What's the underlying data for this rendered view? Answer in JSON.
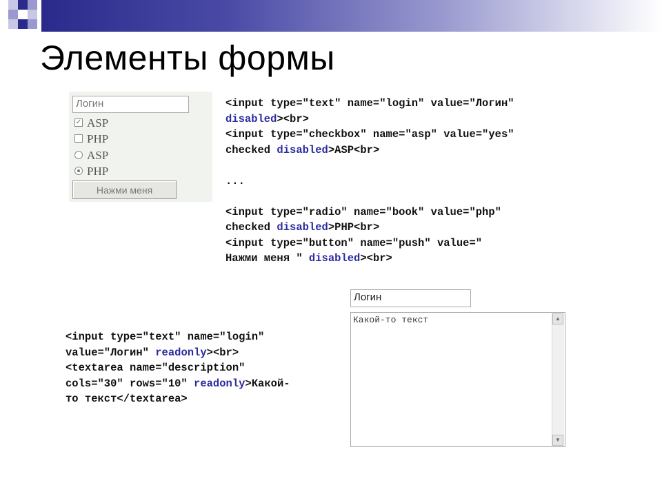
{
  "title": "Элементы формы",
  "colors": {
    "header_dark": "#2a2a8c",
    "keyword": "#2b2b9e",
    "panel_bg": "#f1f4ee"
  },
  "demo1": {
    "login_value": "Логин",
    "checkbox_asp": "ASP",
    "checkbox_php": "PHP",
    "radio_asp": "ASP",
    "radio_php": "PHP",
    "button_label": "Нажми меня"
  },
  "code1": [
    [
      [
        "<input type=\"text\" name=\"login\" value=\"Логин\"",
        ""
      ]
    ],
    [
      [
        "disabled",
        "kw"
      ],
      [
        "><br>",
        ""
      ]
    ],
    [
      [
        "<input type=\"checkbox\" name=\"asp\" value=\"yes\"",
        ""
      ]
    ],
    [
      [
        "checked ",
        ""
      ],
      [
        "disabled",
        "kw"
      ],
      [
        ">ASP<br>",
        ""
      ]
    ],
    [
      [
        "",
        ""
      ]
    ],
    [
      [
        "...",
        ""
      ]
    ],
    [
      [
        "",
        ""
      ]
    ],
    [
      [
        "<input type=\"radio\" name=\"book\" value=\"php\"",
        ""
      ]
    ],
    [
      [
        "checked ",
        ""
      ],
      [
        "disabled",
        "kw"
      ],
      [
        ">PHP<br>",
        ""
      ]
    ],
    [
      [
        "<input type=\"button\" name=\"push\" value=\"",
        ""
      ]
    ],
    [
      [
        "Нажми меня \" ",
        ""
      ],
      [
        "disabled",
        "kw"
      ],
      [
        "><br>",
        ""
      ]
    ]
  ],
  "demo2": {
    "login_value": "Логин",
    "textarea_value": "Какой-то текст"
  },
  "code2": [
    [
      [
        "<input type=\"text\" name=\"login\"",
        ""
      ]
    ],
    [
      [
        "value=\"Логин\" ",
        ""
      ],
      [
        "readonly",
        "kw"
      ],
      [
        "><br>",
        ""
      ]
    ],
    [
      [
        "<textarea name=\"description\"",
        ""
      ]
    ],
    [
      [
        "cols=\"30\" rows=\"10\" ",
        ""
      ],
      [
        "readonly",
        "kw"
      ],
      [
        ">Какой-",
        ""
      ]
    ],
    [
      [
        "то текст</textarea>",
        ""
      ]
    ]
  ]
}
